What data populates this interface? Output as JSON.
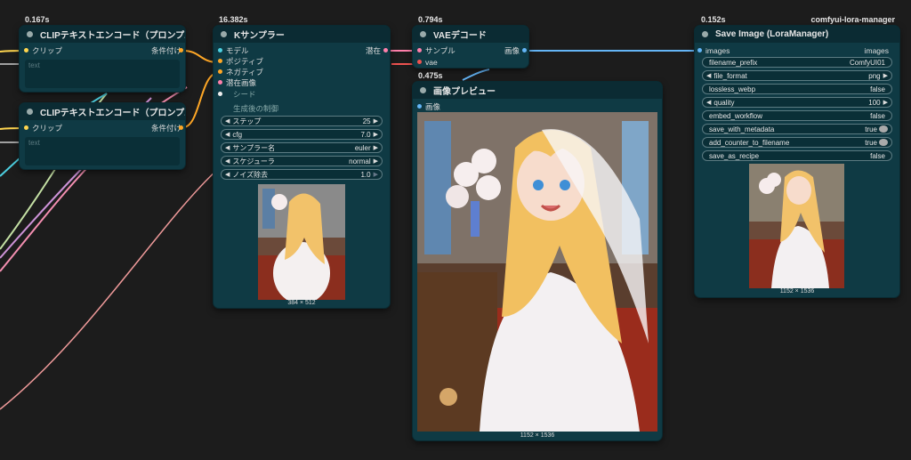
{
  "app": {
    "extension_label": "comfyui-lora-manager"
  },
  "nodes": {
    "clip1": {
      "time": "0.167s",
      "title": "CLIPテキストエンコード（プロンプ...",
      "input": "クリップ",
      "output": "条件付け",
      "text_placeholder": "text"
    },
    "clip2": {
      "title": "CLIPテキストエンコード（プロンプ...",
      "input": "クリップ",
      "output": "条件付け",
      "text_placeholder": "text"
    },
    "ksampler": {
      "time": "16.382s",
      "title": "Kサンプラー",
      "inputs": [
        "モデル",
        "ポジティブ",
        "ネガティブ",
        "潜在画像"
      ],
      "output": "潜在",
      "seed_label": "シード",
      "control_label": "生成後の制御",
      "widgets": [
        {
          "label": "ステップ",
          "value": "25"
        },
        {
          "label": "cfg",
          "value": "7.0"
        },
        {
          "label": "サンプラー名",
          "value": "euler"
        },
        {
          "label": "スケジューラ",
          "value": "normal"
        },
        {
          "label": "ノイズ除去",
          "value": "1.0"
        }
      ],
      "image_size": "384 × 512"
    },
    "vae": {
      "time": "0.794s",
      "title": "VAEデコード",
      "inputs": [
        "サンプル",
        "vae"
      ],
      "output": "画像"
    },
    "preview": {
      "time": "0.475s",
      "title": "画像プレビュー",
      "input": "画像",
      "image_size": "1152 × 1536"
    },
    "save": {
      "time": "0.152s",
      "title": "Save Image (LoraManager)",
      "input": "images",
      "output": "images",
      "widgets": [
        {
          "label": "filename_prefix",
          "value": "ComfyUI01"
        },
        {
          "label": "file_format",
          "value": "png"
        },
        {
          "label": "lossless_webp",
          "value": "false"
        },
        {
          "label": "quality",
          "value": "100"
        },
        {
          "label": "embed_workflow",
          "value": "false"
        },
        {
          "label": "save_with_metadata",
          "value": "true"
        },
        {
          "label": "add_counter_to_filename",
          "value": "true"
        },
        {
          "label": "save_as_recipe",
          "value": "false"
        }
      ],
      "image_size": "1152 × 1536"
    }
  },
  "colors": {
    "model_port": "#b39ddb",
    "clip_port": "#ffd54f",
    "cond_port": "#ffa726",
    "latent_port": "#ff80ab",
    "vae_port": "#ef5350",
    "image_port": "#64b5f6"
  }
}
